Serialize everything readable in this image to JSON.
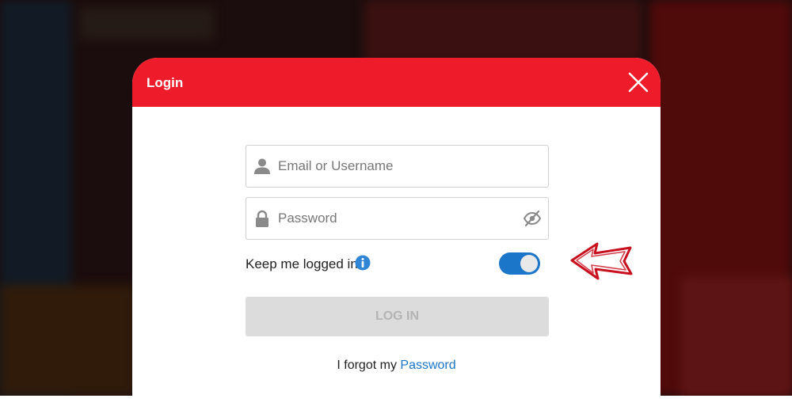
{
  "modal": {
    "title": "Login"
  },
  "form": {
    "username_placeholder": "Email or Username",
    "username_value": "",
    "password_placeholder": "Password",
    "password_value": "",
    "keep_logged_in_label": "Keep me logged in",
    "keep_logged_in_on": true,
    "login_button_label": "LOG IN",
    "forgot_prefix": "I forgot my",
    "forgot_link_label": "Password"
  },
  "icons": {
    "close": "close-icon",
    "user": "user-icon",
    "lock": "lock-icon",
    "eye_off": "eye-off-icon",
    "info": "info-icon",
    "arrow": "arrow-left-icon"
  },
  "colors": {
    "header_red": "#ee1c2b",
    "accent_blue": "#1b75c9",
    "arrow_red": "#c8101e",
    "disabled_bg": "#dcdcdc",
    "disabled_text": "#b4b4b4"
  }
}
